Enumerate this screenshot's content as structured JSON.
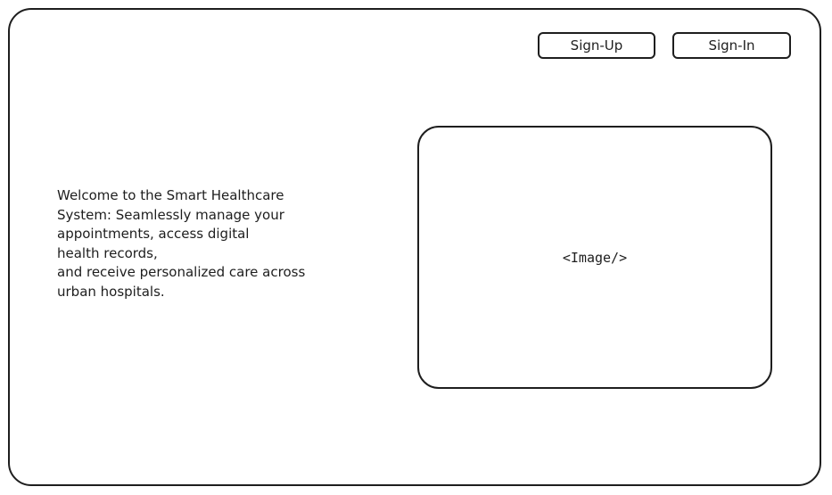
{
  "header": {
    "signup_label": "Sign-Up",
    "signin_label": "Sign-In"
  },
  "main": {
    "welcome_text": "Welcome to the Smart Healthcare\nSystem: Seamlessly manage your\nappointments, access digital\nhealth records,\nand receive personalized care across\nurban hospitals.",
    "image_placeholder": "<Image/>"
  },
  "colors": {
    "stroke": "#1e1e1e",
    "background": "#ffffff"
  }
}
